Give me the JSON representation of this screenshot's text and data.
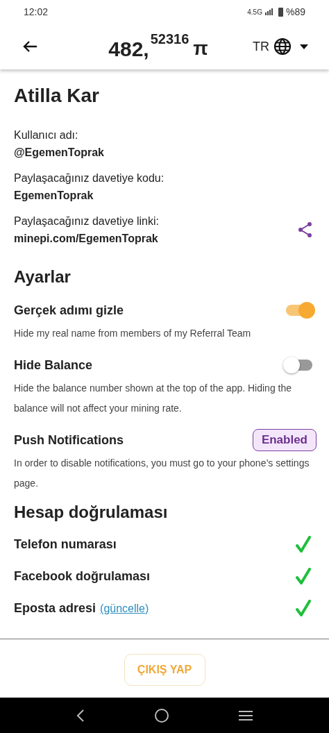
{
  "status_bar": {
    "time": "12:02",
    "network": "4.5G",
    "battery": "%89"
  },
  "header": {
    "balance_integer": "482,",
    "balance_fraction": "52316",
    "currency": "π",
    "language": "TR"
  },
  "profile": {
    "name": "Atilla Kar",
    "fields": [
      {
        "label": "Kullanıcı adı:",
        "value": "@EgemenToprak",
        "shareable": false
      },
      {
        "label": "Paylaşacağınız davetiye kodu:",
        "value": "EgemenToprak",
        "shareable": false
      },
      {
        "label": "Paylaşacağınız davetiye linki:",
        "value": "minepi.com/EgemenToprak",
        "shareable": true
      }
    ]
  },
  "settings": {
    "title": "Ayarlar",
    "items": [
      {
        "kind": "toggle",
        "label": "Gerçek adımı gizle",
        "on": true,
        "description": "Hide my real name from members of my Referral Team"
      },
      {
        "kind": "toggle",
        "label": "Hide Balance",
        "on": false,
        "description": "Hide the balance number shown at the top of the app. Hiding the balance will not affect your mining rate."
      },
      {
        "kind": "badge",
        "label": "Push Notifications",
        "badge": "Enabled",
        "description": "In order to disable notifications, you must go to your phone’s settings page."
      }
    ]
  },
  "verification": {
    "title": "Hesap doğrulaması",
    "items": [
      {
        "label": "Telefon numarası",
        "checked": true
      },
      {
        "label": "Facebook doğrulaması",
        "checked": true
      },
      {
        "label": "Eposta adresi",
        "link": "(güncelle)",
        "checked": true
      }
    ]
  },
  "logout_button": "ÇIKIŞ YAP"
}
